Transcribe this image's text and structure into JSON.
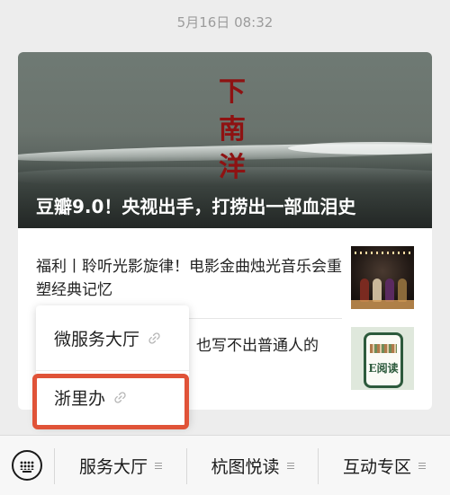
{
  "timestamp": "5月16日 08:32",
  "article": {
    "hero_calligraphy": "下南洋",
    "hero_title": "豆瓣9.0！央视出手，打捞出一部血泪史",
    "items": [
      {
        "title": "福利丨聆听光影旋律！电影金曲烛光音乐会重塑经典记忆",
        "thumb_icon": "concert-thumbnail"
      },
      {
        "title": "也写不出普通人的",
        "thumb_icon": "e-reading-thumbnail",
        "thumb_label": "E阅读"
      }
    ]
  },
  "popup_menu": {
    "items": [
      {
        "label": "微服务大厅",
        "icon": "link-icon"
      },
      {
        "label": "浙里办",
        "icon": "link-icon"
      }
    ],
    "highlight_color": "#e05338"
  },
  "bottom_bar": {
    "keyboard_icon": "keyboard-icon",
    "menus": [
      {
        "label": "服务大厅",
        "icon": "menu-icon"
      },
      {
        "label": "杭图悦读",
        "icon": "menu-icon"
      },
      {
        "label": "互动专区",
        "icon": "menu-icon"
      }
    ]
  }
}
